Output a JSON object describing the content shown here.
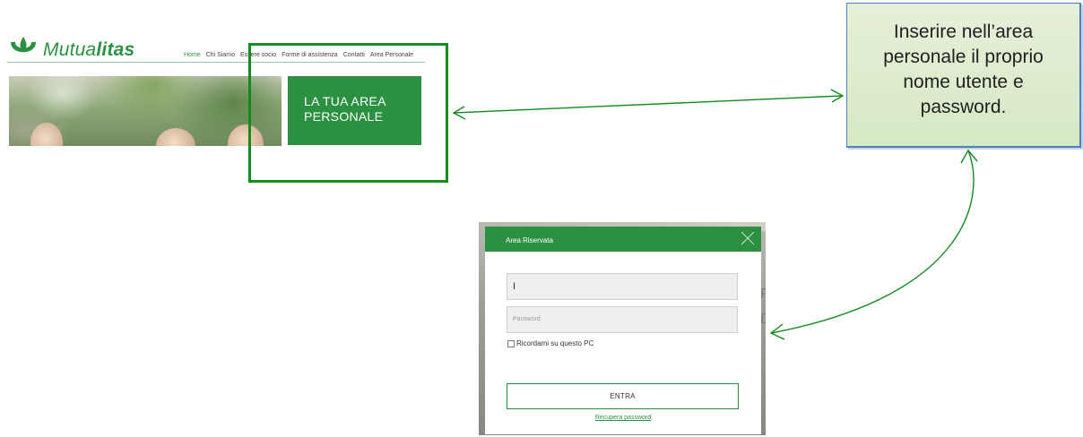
{
  "brand": {
    "name_light": "Mutua",
    "name_bold": "litas",
    "accent_color": "#2b9140"
  },
  "nav": {
    "items": [
      "Home",
      "Chi Siamo",
      "Essere socio",
      "Forme di assistenza",
      "Contatti",
      "Area Personale"
    ]
  },
  "cta": {
    "line1": "LA TUA AREA",
    "line2": "PERSONALE"
  },
  "callout": {
    "lines": [
      "Inserire nell’area",
      "personale il proprio",
      "nome utente e",
      "password."
    ]
  },
  "modal": {
    "title": "Area Riservata",
    "username_value": "I",
    "password_placeholder": "Password",
    "remember_label": "Ricordami su questo PC",
    "submit_label": "ENTRA",
    "recover_link": "Recupera password"
  },
  "icons": {
    "logo": "mutualitas-logo-icon",
    "close": "close-icon",
    "checkbox": "checkbox-icon"
  },
  "colors": {
    "frame": "#138a1e",
    "callout_fill": "#d9eac7",
    "callout_border": "#4f81bd"
  }
}
